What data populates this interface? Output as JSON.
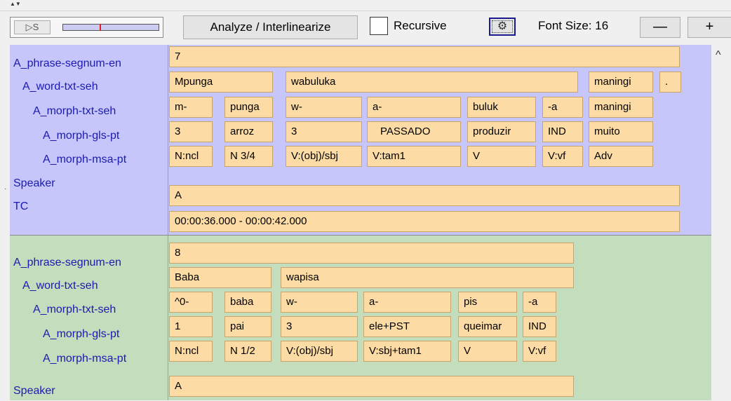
{
  "toolbar": {
    "play_label": "▷S",
    "analyze_label": "Analyze / Interlinearize",
    "recursive_label": "Recursive",
    "recursive_checked": false,
    "font_size_label": "Font Size: 16",
    "minus_label": "—",
    "plus_label": "+",
    "slider_position": 0.39
  },
  "records": [
    {
      "labels": {
        "phrase": "A_phrase-segnum-en",
        "word": "A_word-txt-seh",
        "morph": "A_morph-txt-seh",
        "gls": "A_morph-gls-pt",
        "msa": "A_morph-msa-pt",
        "speaker": "Speaker",
        "tc": "TC"
      },
      "segnum": "7",
      "words": [
        "Mpunga",
        "wabuluka",
        "maningi",
        "."
      ],
      "morphs": [
        "m-",
        "punga",
        "w-",
        "a-",
        "buluk",
        "-a",
        "maningi"
      ],
      "glosses": [
        "3",
        "arroz",
        "3",
        "PASSADO",
        "produzir",
        "IND",
        "muito"
      ],
      "msa": [
        "N:ncl",
        "N 3/4",
        "V:(obj)/sbj",
        "V:tam1",
        "V",
        "V:vf",
        "Adv"
      ],
      "speaker": "A",
      "tc": "00:00:36.000 - 00:00:42.000"
    },
    {
      "labels": {
        "phrase": "A_phrase-segnum-en",
        "word": "A_word-txt-seh",
        "morph": "A_morph-txt-seh",
        "gls": "A_morph-gls-pt",
        "msa": "A_morph-msa-pt",
        "speaker": "Speaker"
      },
      "segnum": "8",
      "words": [
        "Baba",
        "wapisa"
      ],
      "morphs": [
        "^0-",
        "baba",
        "w-",
        "a-",
        "pis",
        "-a"
      ],
      "glosses": [
        "1",
        "pai",
        "3",
        "ele+PST",
        "queimar",
        "IND"
      ],
      "msa": [
        "N:ncl",
        "N 1/2",
        "V:(obj)/sbj",
        "V:sbj+tam1",
        "V",
        "V:vf"
      ],
      "speaker": "A"
    }
  ]
}
